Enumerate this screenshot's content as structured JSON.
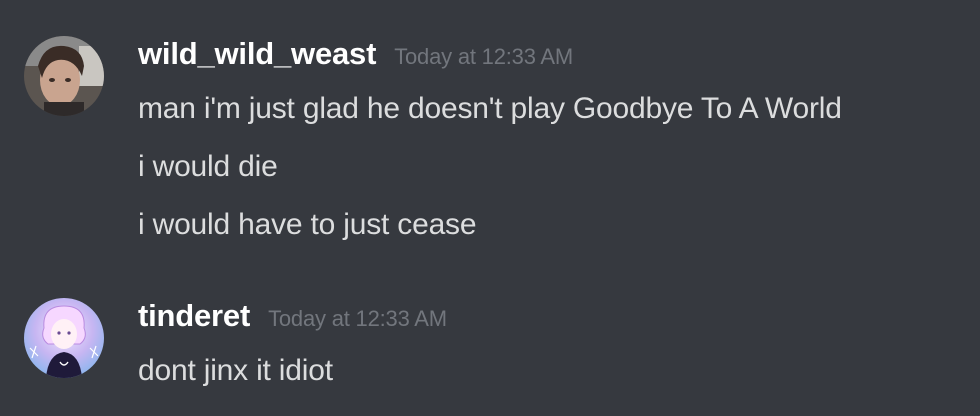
{
  "messages": [
    {
      "username": "wild_wild_weast",
      "timestamp": "Today at 12:33 AM",
      "lines": [
        "man i'm just glad he doesn't play Goodbye To A World",
        "i would die",
        "i would have to just cease"
      ]
    },
    {
      "username": "tinderet",
      "timestamp": "Today at 12:33 AM",
      "lines": [
        "dont jinx it idiot"
      ]
    }
  ],
  "colors": {
    "background": "#36393f",
    "username": "#ffffff",
    "timestamp": "#72767d",
    "message_text": "#dcddde"
  }
}
